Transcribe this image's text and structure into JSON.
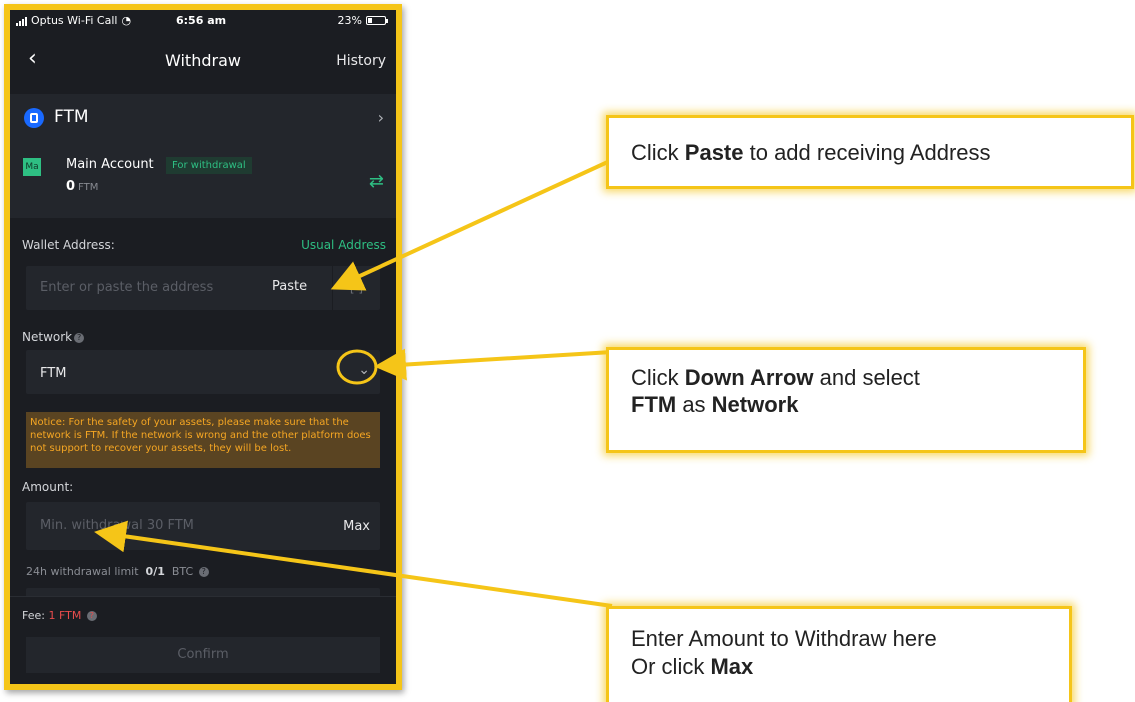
{
  "status_bar": {
    "carrier": "Optus Wi-Fi Call",
    "time": "6:56 am",
    "battery": "23%",
    "battery_level": 0.23
  },
  "nav": {
    "title": "Withdraw",
    "history_label": "History"
  },
  "coin": {
    "name": "FTM"
  },
  "account": {
    "badge": "Ma",
    "name": "Main Account",
    "tag": "For withdrawal",
    "balance": "0",
    "balance_unit": "FTM"
  },
  "wallet": {
    "label": "Wallet Address:",
    "usual_address_label": "Usual Address",
    "placeholder": "Enter or paste the address",
    "paste_label": "Paste"
  },
  "network": {
    "label": "Network",
    "value": "FTM"
  },
  "notice": "Notice: For the safety of your assets, please make sure that the network is FTM. If the network is wrong and the other platform does not support to recover your assets, they will be lost.",
  "amount": {
    "label": "Amount:",
    "placeholder": "Min. withdrawal 30 FTM",
    "max_label": "Max",
    "limit_label": "24h withdrawal limit",
    "limit_value": "0/1",
    "limit_unit": "BTC"
  },
  "fee": {
    "label": "Fee:",
    "value": "1 FTM"
  },
  "confirm_label": "Confirm",
  "callouts": {
    "paste": {
      "pre": "Click ",
      "bold": "Paste",
      "post": " to add receiving Address"
    },
    "network": {
      "pre": "Click ",
      "bold1": "Down Arrow",
      "mid": " and select",
      "bold2": "FTM",
      "mid2": " as ",
      "bold3": "Network"
    },
    "amount": {
      "line1": "Enter Amount to Withdraw here",
      "pre": "Or click ",
      "bold": "Max"
    }
  },
  "colors": {
    "highlight": "#f5c518",
    "accent_green": "#2ebf83",
    "notice_text": "#f5a623",
    "fee_red": "#e94c4c",
    "background_dark": "#1b1d22"
  }
}
